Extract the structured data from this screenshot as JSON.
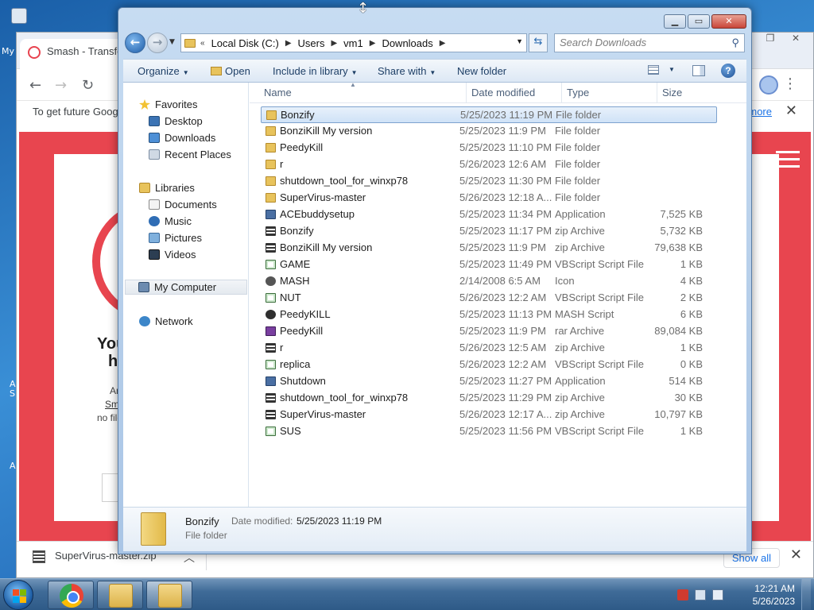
{
  "desktop": {
    "icon_label_1": "My",
    "icon_label_2": "A",
    "icon_label_3": "S",
    "icon_label_4": "A"
  },
  "chrome": {
    "tab_title": "Smash - Transfe",
    "infobar_text": "To get future Goog",
    "infobar_link": "more",
    "page_heading_1": "Your",
    "page_heading_2": "has",
    "page_small_1": "And nov",
    "page_small_2": "Smash",
    "page_small_2b": " to",
    "page_small_3": "no file size",
    "download_file": "SuperVirus-master.zip",
    "show_all": "Show all"
  },
  "explorer": {
    "breadcrumb": [
      "Local Disk (C:)",
      "Users",
      "vm1",
      "Downloads"
    ],
    "search_placeholder": "Search Downloads",
    "toolbar": {
      "organize": "Organize",
      "open": "Open",
      "include_in_library": "Include in library",
      "share_with": "Share with",
      "new_folder": "New folder"
    },
    "nav": {
      "favorites": "Favorites",
      "desktop": "Desktop",
      "downloads": "Downloads",
      "recent_places": "Recent Places",
      "libraries": "Libraries",
      "documents": "Documents",
      "music": "Music",
      "pictures": "Pictures",
      "videos": "Videos",
      "my_computer": "My Computer",
      "network": "Network"
    },
    "columns": {
      "name": "Name",
      "date": "Date modified",
      "type": "Type",
      "size": "Size"
    },
    "files": [
      {
        "name": "Bonzify",
        "date": "5/25/2023 11:19 PM",
        "type": "File folder",
        "size": "",
        "kind": "folder"
      },
      {
        "name": "BonziKill My version",
        "date": "5/25/2023 11:9 PM",
        "type": "File folder",
        "size": "",
        "kind": "folder"
      },
      {
        "name": "PeedyKill",
        "date": "5/25/2023 11:10 PM",
        "type": "File folder",
        "size": "",
        "kind": "folder"
      },
      {
        "name": "r",
        "date": "5/26/2023 12:6 AM",
        "type": "File folder",
        "size": "",
        "kind": "folder"
      },
      {
        "name": "shutdown_tool_for_winxp78",
        "date": "5/25/2023 11:30 PM",
        "type": "File folder",
        "size": "",
        "kind": "folder"
      },
      {
        "name": "SuperVirus-master",
        "date": "5/26/2023 12:18 A...",
        "type": "File folder",
        "size": "",
        "kind": "folder"
      },
      {
        "name": "ACEbuddysetup",
        "date": "5/25/2023 11:34 PM",
        "type": "Application",
        "size": "7,525 KB",
        "kind": "app"
      },
      {
        "name": "Bonzify",
        "date": "5/25/2023 11:17 PM",
        "type": "zip Archive",
        "size": "5,732 KB",
        "kind": "zip"
      },
      {
        "name": "BonziKill My version",
        "date": "5/25/2023 11:9 PM",
        "type": "zip Archive",
        "size": "79,638 KB",
        "kind": "zip"
      },
      {
        "name": "GAME",
        "date": "5/25/2023 11:49 PM",
        "type": "VBScript Script File",
        "size": "1 KB",
        "kind": "vbs"
      },
      {
        "name": "MASH",
        "date": "2/14/2008 6:5 AM",
        "type": "Icon",
        "size": "4 KB",
        "kind": "iconfile"
      },
      {
        "name": "NUT",
        "date": "5/26/2023 12:2 AM",
        "type": "VBScript Script File",
        "size": "2 KB",
        "kind": "vbs"
      },
      {
        "name": "PeedyKILL",
        "date": "5/25/2023 11:13 PM",
        "type": "MASH Script",
        "size": "6 KB",
        "kind": "mash"
      },
      {
        "name": "PeedyKill",
        "date": "5/25/2023 11:9 PM",
        "type": "rar Archive",
        "size": "89,084 KB",
        "kind": "rar"
      },
      {
        "name": "r",
        "date": "5/26/2023 12:5 AM",
        "type": "zip Archive",
        "size": "1 KB",
        "kind": "zip"
      },
      {
        "name": "replica",
        "date": "5/26/2023 12:2 AM",
        "type": "VBScript Script File",
        "size": "0 KB",
        "kind": "vbs"
      },
      {
        "name": "Shutdown",
        "date": "5/25/2023 11:27 PM",
        "type": "Application",
        "size": "514 KB",
        "kind": "app"
      },
      {
        "name": "shutdown_tool_for_winxp78",
        "date": "5/25/2023 11:29 PM",
        "type": "zip Archive",
        "size": "30 KB",
        "kind": "zip"
      },
      {
        "name": "SuperVirus-master",
        "date": "5/26/2023 12:17 A...",
        "type": "zip Archive",
        "size": "10,797 KB",
        "kind": "zip"
      },
      {
        "name": "SUS",
        "date": "5/25/2023 11:56 PM",
        "type": "VBScript Script File",
        "size": "1 KB",
        "kind": "vbs"
      }
    ],
    "details": {
      "name": "Bonzify",
      "modified_label": "Date modified:",
      "modified_value": "5/25/2023 11:19 PM",
      "type": "File folder"
    }
  },
  "taskbar": {
    "time": "12:21 AM",
    "date": "5/26/2023"
  },
  "colors": {
    "accent_red": "#e8454f",
    "selection": "#cfe2f7",
    "taskbar": "#3f6b98"
  }
}
